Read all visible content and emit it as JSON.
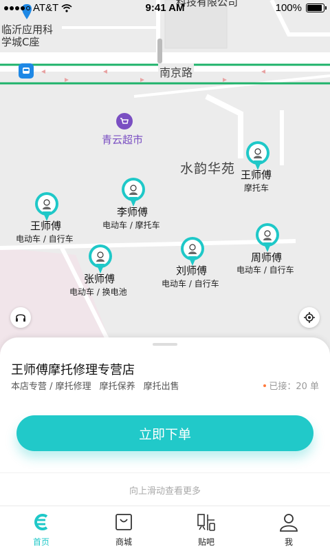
{
  "status_bar": {
    "carrier": "AT&T",
    "time": "9:41 AM",
    "battery": "100%"
  },
  "map": {
    "poi_school": "临沂应用科\n学城C座",
    "poi_company": "科技有限公司",
    "road": "南京路",
    "supermarket": "青云超市",
    "area": "水韵华苑",
    "masters": [
      {
        "name": "王师傅",
        "tags": "摩托车"
      },
      {
        "name": "李师傅",
        "tags": "电动车 / 摩托车"
      },
      {
        "name": "王师傅",
        "tags": "电动车 / 自行车"
      },
      {
        "name": "周师傅",
        "tags": "电动车 / 自行车"
      },
      {
        "name": "刘师傅",
        "tags": "电动车 / 自行车"
      },
      {
        "name": "张师傅",
        "tags": "电动车 / 换电池"
      }
    ],
    "service_icon": "headset-icon",
    "locate_icon": "locate-icon"
  },
  "sheet": {
    "shop_title": "王师傅摩托修理专营店",
    "services": [
      "本店专营 / 摩托修理",
      "摩托保养",
      "摩托出售"
    ],
    "accepted": "已接：20 单",
    "order_button": "立即下单",
    "more_hint": "向上滑动查看更多"
  },
  "tabbar": {
    "tabs": [
      {
        "label": "首页",
        "icon": "home-icon",
        "active": true
      },
      {
        "label": "商城",
        "icon": "shopping-bag-icon",
        "active": false
      },
      {
        "label": "贴吧",
        "icon": "tieba-icon",
        "active": false
      },
      {
        "label": "我",
        "icon": "profile-icon",
        "active": false
      }
    ]
  },
  "colors": {
    "accent": "#21c9c9",
    "road_green": "#1fb36b",
    "supermarket": "#7a4fc2",
    "accepted_dot": "#ff7a3d"
  }
}
